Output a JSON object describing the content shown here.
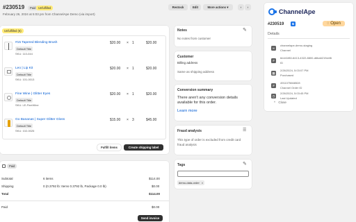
{
  "order": {
    "number": "#230519",
    "paid_badge": "Paid",
    "fulfillment_badge": "Unfulfilled",
    "date_line": "February 26, 2024 at 5:03 pm from ChannelApe Demo (via import)",
    "restock_label": "Restock",
    "edit_label": "Edit",
    "more_actions_label": "More actions",
    "prev_icon": "chevron-left-icon",
    "next_icon": "chevron-right-icon"
  },
  "unfulfilled_card": {
    "badge": "Unfulfilled (6)",
    "items": [
      {
        "title": "#15 Tapered Blending Brush",
        "variant": "Default Title",
        "sku": "SKU: 110-044",
        "price": "$20.00",
        "times": "×",
        "qty": "1",
        "total": "$20.00"
      },
      {
        "title": "Leo | Lip Kit",
        "variant": "Default Title",
        "sku": "SKU: 101-0013",
        "price": "$20.00",
        "times": "×",
        "qty": "1",
        "total": "$20.00"
      },
      {
        "title": "Fine Wine | Glitter Eyes",
        "variant": "Default Title",
        "sku": "SKU: LE-FineWine",
        "price": "$20.00",
        "times": "×",
        "qty": "1",
        "total": "$20.00"
      },
      {
        "title": "Go Bananas | Super Glitter Gloss",
        "variant": "Default Title",
        "sku": "SKU: 102-0026",
        "price": "$15.00",
        "times": "×",
        "qty": "3",
        "total": "$45.00"
      }
    ],
    "fulfill_label": "Fulfill items",
    "create_label": "Create shipping label"
  },
  "payment_card": {
    "badge": "Paid",
    "rows": [
      {
        "label": "Subtotal",
        "detail": "6 items",
        "value": "$114.00"
      },
      {
        "label": "Shipping",
        "detail": "0 (0.3792 lb: Items 0.3792 lb, Package 0.0 lb)",
        "value": "$0.00"
      },
      {
        "label": "Total",
        "detail": "",
        "value": "$114.00"
      },
      {
        "label": "Paid",
        "detail": "",
        "value": "$0.00"
      }
    ],
    "send_invoice_label": "Send invoice"
  },
  "notes": {
    "title": "Notes",
    "text": "No notes from customer"
  },
  "customer": {
    "title": "Customer",
    "billing_title": "Billing address",
    "billing_text": "Same as shipping address"
  },
  "conversion": {
    "title": "Conversion summary",
    "text": "There aren't any conversion details available for this order.",
    "link": "Learn more"
  },
  "fraud": {
    "title": "Fraud analysis",
    "text": "This type of order is excluded from credit card fraud analysis"
  },
  "tags": {
    "title": "Tags",
    "input_value": "",
    "chip": "demo-data-order",
    "chip_remove": "×"
  },
  "side_panel": {
    "brand": "ChannelApe",
    "order_number": "#230519",
    "status": "Open",
    "details_title": "Details",
    "details": [
      {
        "icon": "link-icon",
        "value": "channelape-demo-staging",
        "label": "Channel"
      },
      {
        "icon": "hash-icon",
        "value": "bb441f80-6413-4322-8800-d6ba6219cbf6",
        "label": "ID"
      },
      {
        "icon": "calendar-icon",
        "value": "2/26/2024, 5:03:07 PM",
        "label": "Purchased"
      },
      {
        "icon": "hash-icon",
        "value": "4911075668528",
        "label": "Channel Order ID"
      },
      {
        "icon": "calendar-icon",
        "value": "2/26/2024, 5:03:45 PM",
        "label": "Last Updated"
      }
    ],
    "close_label": "Close"
  },
  "colors": {
    "accent": "#005bd3",
    "paid_badge": "#e3e3e3",
    "unfulfilled_badge": "#ffeb78",
    "open_badge": "#ffd79d",
    "brand_blue": "#1a73e8"
  }
}
